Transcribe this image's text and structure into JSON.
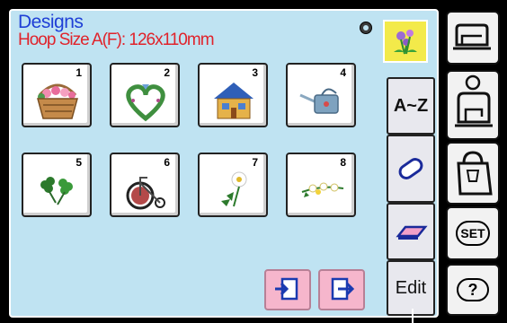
{
  "header": {
    "title": "Designs",
    "hoop_size": "Hoop Size A(F): 126x110mm"
  },
  "designs": [
    {
      "number": "1",
      "icon": "flower-basket-icon"
    },
    {
      "number": "2",
      "icon": "heart-wreath-icon"
    },
    {
      "number": "3",
      "icon": "house-icon"
    },
    {
      "number": "4",
      "icon": "watering-can-icon"
    },
    {
      "number": "5",
      "icon": "clover-icon"
    },
    {
      "number": "6",
      "icon": "bicycle-icon"
    },
    {
      "number": "7",
      "icon": "daisy-icon"
    },
    {
      "number": "8",
      "icon": "flower-spray-icon"
    }
  ],
  "tabs": {
    "alphabet_label": "A~Z",
    "edit_label": "Edit"
  },
  "side": {
    "set_label": "SET",
    "help_label": "?"
  },
  "colors": {
    "screen": "#bfe3f2",
    "title": "#1f3fd6",
    "hoop": "#e0232b",
    "nav": "#f6b6cc",
    "thumb": "#f3ea4a"
  }
}
